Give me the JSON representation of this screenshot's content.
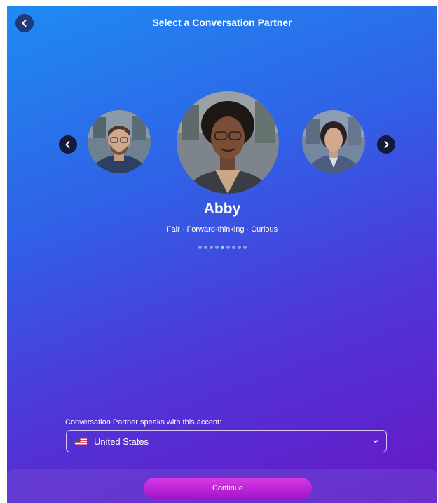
{
  "header": {
    "title": "Select a Conversation Partner",
    "back_icon": "chevron-left-icon"
  },
  "carousel": {
    "prev_icon": "chevron-left-icon",
    "next_icon": "chevron-right-icon",
    "partners": [
      {
        "position": "previous",
        "description": "man with glasses and beard"
      },
      {
        "position": "selected",
        "description": "woman with glasses and curly hair"
      },
      {
        "position": "next",
        "description": "woman in blazer"
      }
    ],
    "selected_name": "Abby",
    "selected_traits": "Fair · Forward-thinking · Curious",
    "page_count": 9,
    "active_page": 4
  },
  "accent": {
    "label": "Conversation Partner speaks with this accent:",
    "selected": "United States",
    "flag_icon": "us-flag-icon",
    "dropdown_icon": "chevron-down-icon"
  },
  "footer": {
    "continue_label": "Continue"
  },
  "colors": {
    "gradient_start": "#1f8bf2",
    "gradient_end": "#6817c4",
    "button_accent": "#c42ad8"
  }
}
